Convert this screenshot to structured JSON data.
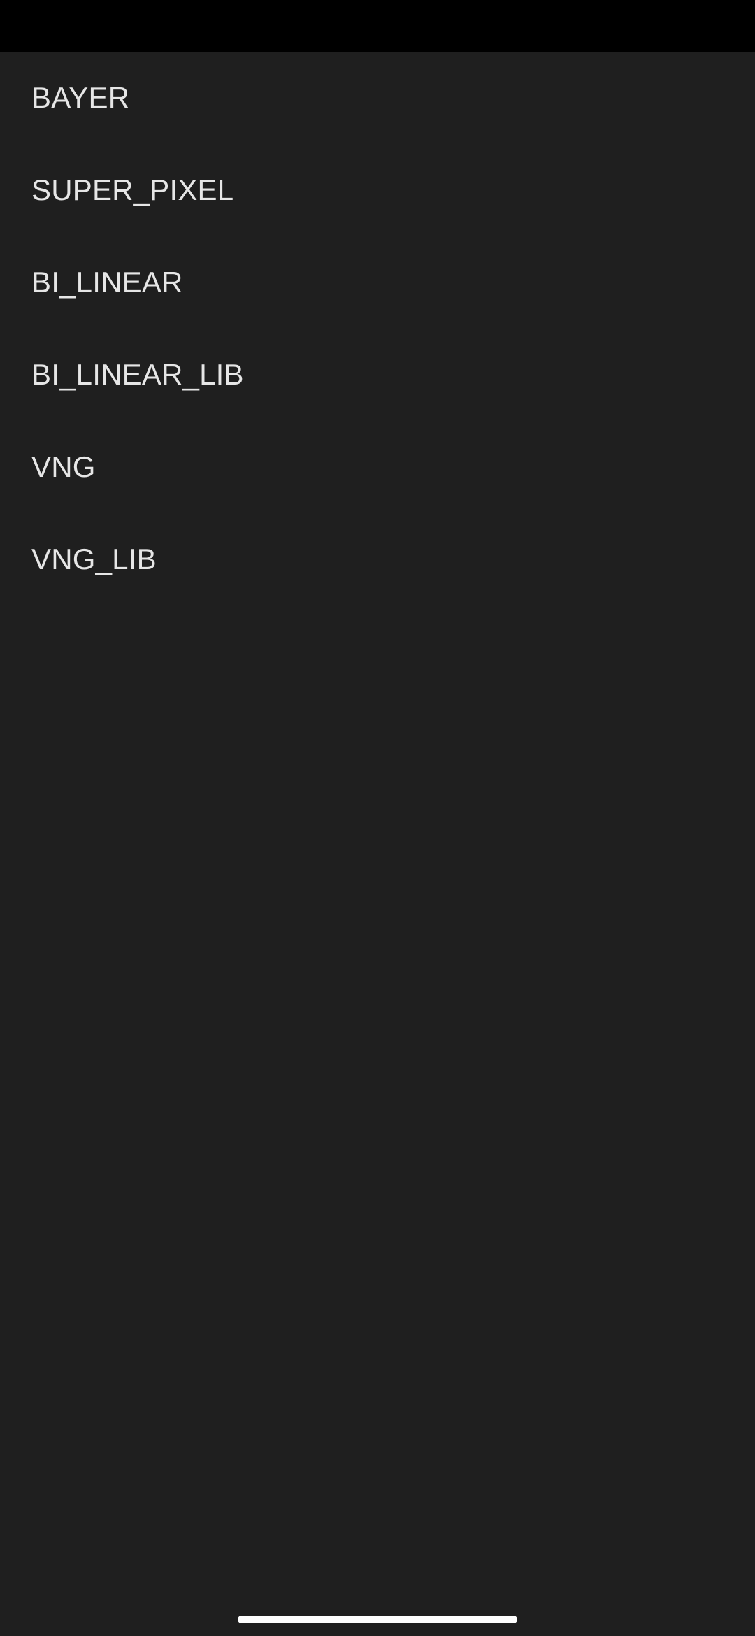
{
  "menu": {
    "items": [
      {
        "label": "BAYER"
      },
      {
        "label": "SUPER_PIXEL"
      },
      {
        "label": "BI_LINEAR"
      },
      {
        "label": "BI_LINEAR_LIB"
      },
      {
        "label": "VNG"
      },
      {
        "label": "VNG_LIB"
      }
    ]
  },
  "colors": {
    "background": "#1f1f1f",
    "status_bar": "#000000",
    "text": "#e6e6e6",
    "home_indicator": "#ffffff"
  }
}
